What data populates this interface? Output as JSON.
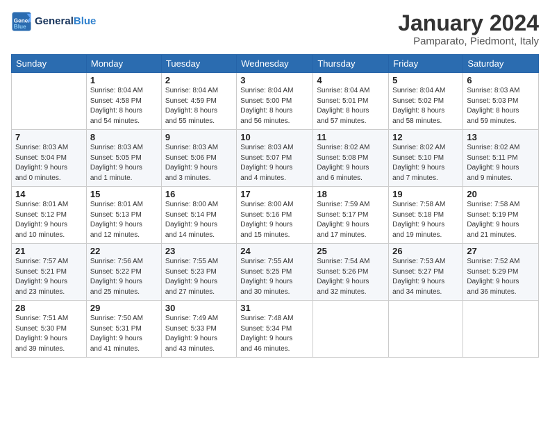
{
  "header": {
    "logo_general": "General",
    "logo_blue": "Blue",
    "month": "January 2024",
    "location": "Pamparato, Piedmont, Italy"
  },
  "columns": [
    "Sunday",
    "Monday",
    "Tuesday",
    "Wednesday",
    "Thursday",
    "Friday",
    "Saturday"
  ],
  "weeks": [
    [
      {
        "day": "",
        "info": ""
      },
      {
        "day": "1",
        "info": "Sunrise: 8:04 AM\nSunset: 4:58 PM\nDaylight: 8 hours\nand 54 minutes."
      },
      {
        "day": "2",
        "info": "Sunrise: 8:04 AM\nSunset: 4:59 PM\nDaylight: 8 hours\nand 55 minutes."
      },
      {
        "day": "3",
        "info": "Sunrise: 8:04 AM\nSunset: 5:00 PM\nDaylight: 8 hours\nand 56 minutes."
      },
      {
        "day": "4",
        "info": "Sunrise: 8:04 AM\nSunset: 5:01 PM\nDaylight: 8 hours\nand 57 minutes."
      },
      {
        "day": "5",
        "info": "Sunrise: 8:04 AM\nSunset: 5:02 PM\nDaylight: 8 hours\nand 58 minutes."
      },
      {
        "day": "6",
        "info": "Sunrise: 8:03 AM\nSunset: 5:03 PM\nDaylight: 8 hours\nand 59 minutes."
      }
    ],
    [
      {
        "day": "7",
        "info": "Sunrise: 8:03 AM\nSunset: 5:04 PM\nDaylight: 9 hours\nand 0 minutes."
      },
      {
        "day": "8",
        "info": "Sunrise: 8:03 AM\nSunset: 5:05 PM\nDaylight: 9 hours\nand 1 minute."
      },
      {
        "day": "9",
        "info": "Sunrise: 8:03 AM\nSunset: 5:06 PM\nDaylight: 9 hours\nand 3 minutes."
      },
      {
        "day": "10",
        "info": "Sunrise: 8:03 AM\nSunset: 5:07 PM\nDaylight: 9 hours\nand 4 minutes."
      },
      {
        "day": "11",
        "info": "Sunrise: 8:02 AM\nSunset: 5:08 PM\nDaylight: 9 hours\nand 6 minutes."
      },
      {
        "day": "12",
        "info": "Sunrise: 8:02 AM\nSunset: 5:10 PM\nDaylight: 9 hours\nand 7 minutes."
      },
      {
        "day": "13",
        "info": "Sunrise: 8:02 AM\nSunset: 5:11 PM\nDaylight: 9 hours\nand 9 minutes."
      }
    ],
    [
      {
        "day": "14",
        "info": "Sunrise: 8:01 AM\nSunset: 5:12 PM\nDaylight: 9 hours\nand 10 minutes."
      },
      {
        "day": "15",
        "info": "Sunrise: 8:01 AM\nSunset: 5:13 PM\nDaylight: 9 hours\nand 12 minutes."
      },
      {
        "day": "16",
        "info": "Sunrise: 8:00 AM\nSunset: 5:14 PM\nDaylight: 9 hours\nand 14 minutes."
      },
      {
        "day": "17",
        "info": "Sunrise: 8:00 AM\nSunset: 5:16 PM\nDaylight: 9 hours\nand 15 minutes."
      },
      {
        "day": "18",
        "info": "Sunrise: 7:59 AM\nSunset: 5:17 PM\nDaylight: 9 hours\nand 17 minutes."
      },
      {
        "day": "19",
        "info": "Sunrise: 7:58 AM\nSunset: 5:18 PM\nDaylight: 9 hours\nand 19 minutes."
      },
      {
        "day": "20",
        "info": "Sunrise: 7:58 AM\nSunset: 5:19 PM\nDaylight: 9 hours\nand 21 minutes."
      }
    ],
    [
      {
        "day": "21",
        "info": "Sunrise: 7:57 AM\nSunset: 5:21 PM\nDaylight: 9 hours\nand 23 minutes."
      },
      {
        "day": "22",
        "info": "Sunrise: 7:56 AM\nSunset: 5:22 PM\nDaylight: 9 hours\nand 25 minutes."
      },
      {
        "day": "23",
        "info": "Sunrise: 7:55 AM\nSunset: 5:23 PM\nDaylight: 9 hours\nand 27 minutes."
      },
      {
        "day": "24",
        "info": "Sunrise: 7:55 AM\nSunset: 5:25 PM\nDaylight: 9 hours\nand 30 minutes."
      },
      {
        "day": "25",
        "info": "Sunrise: 7:54 AM\nSunset: 5:26 PM\nDaylight: 9 hours\nand 32 minutes."
      },
      {
        "day": "26",
        "info": "Sunrise: 7:53 AM\nSunset: 5:27 PM\nDaylight: 9 hours\nand 34 minutes."
      },
      {
        "day": "27",
        "info": "Sunrise: 7:52 AM\nSunset: 5:29 PM\nDaylight: 9 hours\nand 36 minutes."
      }
    ],
    [
      {
        "day": "28",
        "info": "Sunrise: 7:51 AM\nSunset: 5:30 PM\nDaylight: 9 hours\nand 39 minutes."
      },
      {
        "day": "29",
        "info": "Sunrise: 7:50 AM\nSunset: 5:31 PM\nDaylight: 9 hours\nand 41 minutes."
      },
      {
        "day": "30",
        "info": "Sunrise: 7:49 AM\nSunset: 5:33 PM\nDaylight: 9 hours\nand 43 minutes."
      },
      {
        "day": "31",
        "info": "Sunrise: 7:48 AM\nSunset: 5:34 PM\nDaylight: 9 hours\nand 46 minutes."
      },
      {
        "day": "",
        "info": ""
      },
      {
        "day": "",
        "info": ""
      },
      {
        "day": "",
        "info": ""
      }
    ]
  ]
}
